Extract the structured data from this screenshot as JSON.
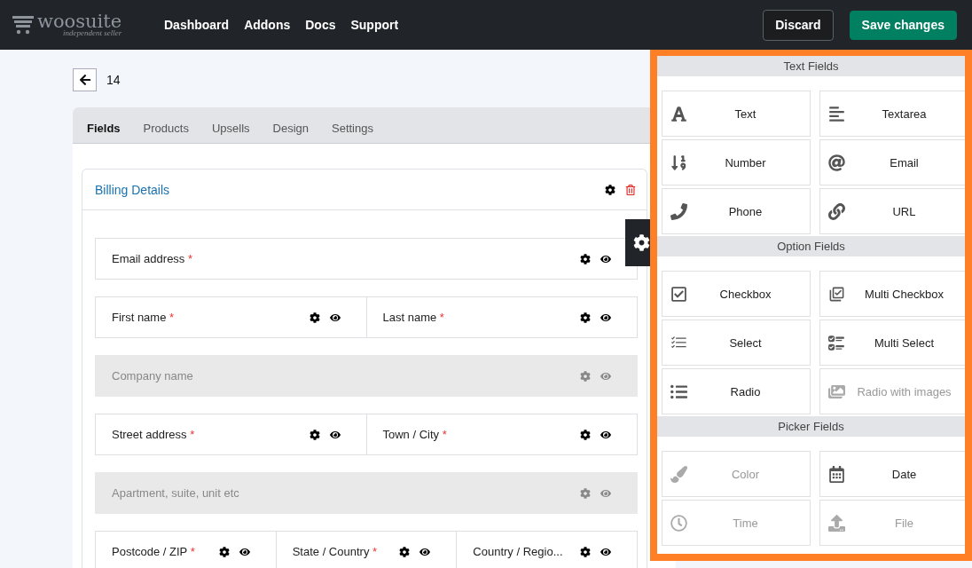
{
  "topbar": {
    "logo": {
      "name": "woosuite",
      "tagline": "independent seller"
    },
    "nav": [
      "Dashboard",
      "Addons",
      "Docs",
      "Support"
    ],
    "buttons": [
      {
        "kind": "outline",
        "label": "Discard"
      },
      {
        "kind": "primary",
        "label": "Save changes"
      }
    ]
  },
  "page": {
    "title": "14"
  },
  "tabs": [
    {
      "label": "Fields",
      "selected": true
    },
    {
      "label": "Products",
      "selected": false
    },
    {
      "label": "Upsells",
      "selected": false
    },
    {
      "label": "Design",
      "selected": false
    },
    {
      "label": "Settings",
      "selected": false
    }
  ],
  "section": {
    "title": "Billing Details",
    "rows": [
      {
        "cells": [
          {
            "label": "Email address",
            "asterisk": "*",
            "disabled": false
          }
        ]
      },
      {
        "cells": [
          {
            "label": "First name",
            "asterisk": "*",
            "disabled": false
          },
          {
            "label": "Last name",
            "asterisk": "*",
            "disabled": false
          }
        ]
      },
      {
        "cells": [
          {
            "label": "Company name",
            "disabled": true
          }
        ]
      },
      {
        "cells": [
          {
            "label": "Street address",
            "asterisk": "*",
            "disabled": false
          },
          {
            "label": "Town / City",
            "asterisk": "*",
            "disabled": false
          }
        ]
      },
      {
        "cells": [
          {
            "label": "Apartment, suite, unit etc",
            "disabled": true
          }
        ]
      },
      {
        "cells": [
          {
            "label": "Postcode / ZIP",
            "asterisk": "*",
            "disabled": false
          },
          {
            "label": "State / Country",
            "asterisk": "*",
            "disabled": false
          },
          {
            "label": "Country / Regio...",
            "disabled": false
          }
        ]
      }
    ]
  },
  "palette": [
    {
      "title": "Text Fields",
      "items": [
        {
          "kind": "text",
          "label": "Text",
          "disabled": false
        },
        {
          "kind": "textarea",
          "label": "Textarea",
          "disabled": false
        },
        {
          "kind": "number",
          "label": "Number",
          "disabled": false
        },
        {
          "kind": "email",
          "label": "Email",
          "disabled": false
        },
        {
          "kind": "phone",
          "label": "Phone",
          "disabled": false
        },
        {
          "kind": "url",
          "label": "URL",
          "disabled": false
        }
      ]
    },
    {
      "title": "Option Fields",
      "items": [
        {
          "kind": "checkbox",
          "label": "Checkbox",
          "disabled": false
        },
        {
          "kind": "multicheckbox",
          "label": "Multi Checkbox",
          "disabled": false
        },
        {
          "kind": "select",
          "label": "Select",
          "disabled": false
        },
        {
          "kind": "multiselect",
          "label": "Multi Select",
          "disabled": false
        },
        {
          "kind": "radio",
          "label": "Radio",
          "disabled": false
        },
        {
          "kind": "imageradio",
          "label": "Radio with images",
          "disabled": true
        }
      ]
    },
    {
      "title": "Picker Fields",
      "items": [
        {
          "kind": "color",
          "label": "Color",
          "disabled": true
        },
        {
          "kind": "date",
          "label": "Date",
          "disabled": false
        },
        {
          "kind": "time",
          "label": "Time",
          "disabled": true
        },
        {
          "kind": "file",
          "label": "File",
          "disabled": true
        }
      ]
    }
  ]
}
